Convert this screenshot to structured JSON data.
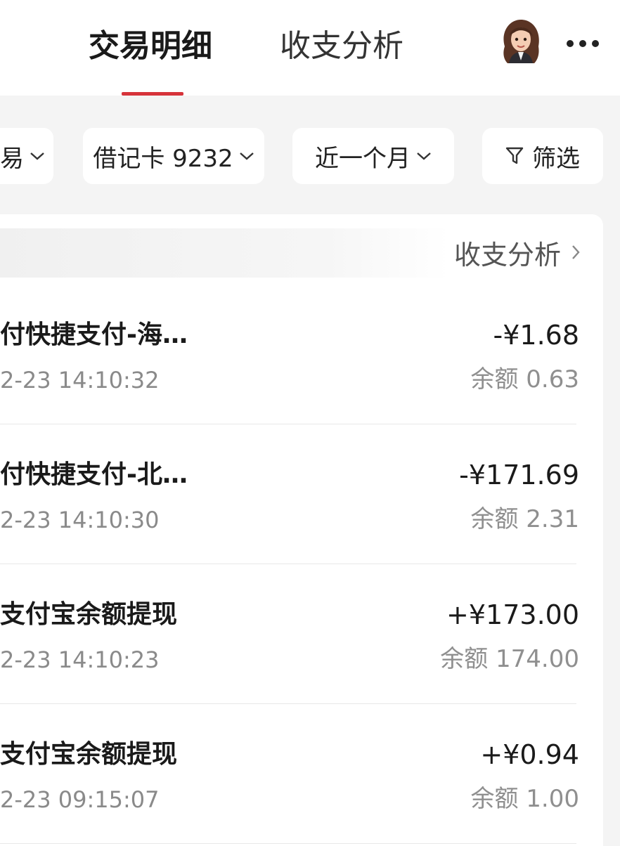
{
  "header": {
    "tab_active": "交易明细",
    "tab_inactive": "收支分析",
    "accent_color": "#d6333a",
    "avatar_icon": "avatar-woman-icon",
    "more_icon": "more-dots-icon"
  },
  "filters": {
    "type_label_partial": "易",
    "card_label": "借记卡 9232",
    "period_label": "近一个月",
    "filter_label": "筛选"
  },
  "card": {
    "analysis_link": "收支分析"
  },
  "transactions": [
    {
      "title": "付快捷支付-海…",
      "time": "2-23 14:10:32",
      "amount": "-¥1.68",
      "balance": "余额 0.63"
    },
    {
      "title": "付快捷支付-北…",
      "time": "2-23 14:10:30",
      "amount": "-¥171.69",
      "balance": "余额 2.31"
    },
    {
      "title": "支付宝余额提现",
      "time": "2-23 14:10:23",
      "amount": "+¥173.00",
      "balance": "余额 174.00"
    },
    {
      "title": "支付宝余额提现",
      "time": "2-23 09:15:07",
      "amount": "+¥0.94",
      "balance": "余额 1.00"
    }
  ]
}
